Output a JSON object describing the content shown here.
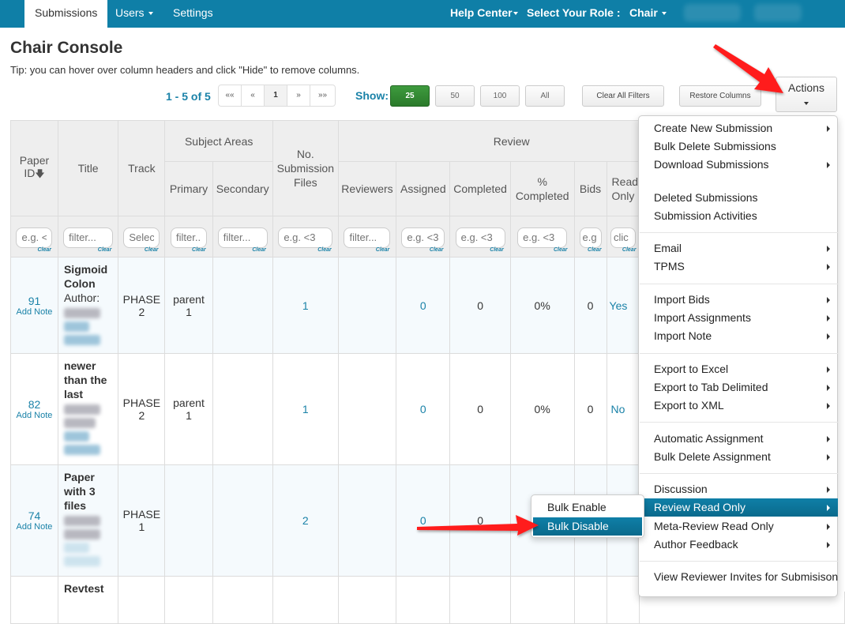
{
  "navbar": {
    "tabs": [
      {
        "label": "Submissions",
        "active": true
      },
      {
        "label": "Users",
        "has_dropdown": true
      },
      {
        "label": "Settings"
      }
    ],
    "help_center": "Help Center",
    "role_label": "Select Your Role :",
    "role_value": "Chair"
  },
  "header": {
    "title": "Chair Console",
    "tip": "Tip: you can hover over column headers and click \"Hide\" to remove columns."
  },
  "toolbar": {
    "range": "1 - 5 of 5",
    "pager": {
      "first": "««",
      "prev": "«",
      "current": "1",
      "next": "»",
      "last": "»»"
    },
    "show_label": "Show:",
    "page_sizes": [
      "25",
      "50",
      "100",
      "All"
    ],
    "selected_page_size": "25",
    "clear_filters": "Clear All Filters",
    "restore_columns": "Restore Columns",
    "actions": "Actions"
  },
  "table": {
    "headers": {
      "paper_id": "Paper ID",
      "title": "Title",
      "track": "Track",
      "subject_areas": "Subject Areas",
      "primary": "Primary",
      "secondary": "Secondary",
      "num_files": "No. Submission Files",
      "review": "Review",
      "reviewers": "Reviewers",
      "assigned": "Assigned",
      "completed": "Completed",
      "pct_completed": "% Completed",
      "bids": "Bids",
      "read_only": "Read Only"
    },
    "filters": {
      "paper_id": "e.g. <",
      "title": "filter...",
      "track": "Select",
      "primary": "filter...",
      "secondary": "filter...",
      "num_files": "e.g. <3",
      "reviewers": "filter...",
      "assigned": "e.g. <3",
      "completed": "e.g. <3",
      "pct_completed": "e.g. <3",
      "bids": "e.g",
      "read_only": "clic",
      "clear": "Clear"
    },
    "rows": [
      {
        "id": "91",
        "add_note": "Add Note",
        "title": "Sigmoid Colon",
        "author_label": "Author:",
        "track_line1": "PHASE",
        "track_line2": "2",
        "primary_line1": "parent",
        "primary_line2": "1",
        "secondary": "",
        "num_files": "1",
        "reviewers": "",
        "assigned": "0",
        "completed": "0",
        "pct_completed": "0%",
        "bids": "0",
        "read_only": "Yes"
      },
      {
        "id": "82",
        "add_note": "Add Note",
        "title": "newer than the last",
        "author_label": "",
        "track_line1": "PHASE",
        "track_line2": "2",
        "primary_line1": "parent",
        "primary_line2": "1",
        "secondary": "",
        "num_files": "1",
        "reviewers": "",
        "assigned": "0",
        "completed": "0",
        "pct_completed": "0%",
        "bids": "0",
        "read_only": "No"
      },
      {
        "id": "74",
        "add_note": "Add Note",
        "title": "Paper with 3 files",
        "author_label": "",
        "track_line1": "PHASE",
        "track_line2": "1",
        "primary_line1": "",
        "primary_line2": "",
        "secondary": "",
        "num_files": "2",
        "reviewers": "",
        "assigned": "0",
        "completed": "0",
        "pct_completed": "",
        "bids": "",
        "read_only": ""
      },
      {
        "id": "",
        "add_note": "",
        "title": "Revtest",
        "author_label": "",
        "track_line1": "",
        "track_line2": "",
        "primary_line1": "",
        "primary_line2": "",
        "secondary": "",
        "num_files": "",
        "reviewers": "",
        "assigned": "",
        "completed": "",
        "pct_completed": "",
        "bids": "",
        "read_only": ""
      }
    ]
  },
  "actions_menu": {
    "groups": [
      [
        {
          "label": "Create New Submission",
          "submenu": true
        },
        {
          "label": "Bulk Delete Submissions",
          "submenu": false
        },
        {
          "label": "Download Submissions",
          "submenu": true
        },
        {
          "label": "",
          "spacer": true
        },
        {
          "label": "Deleted Submissions",
          "submenu": false
        },
        {
          "label": "Submission Activities",
          "submenu": false
        }
      ],
      [
        {
          "label": "Email",
          "submenu": true
        },
        {
          "label": "TPMS",
          "submenu": true
        }
      ],
      [
        {
          "label": "Import Bids",
          "submenu": true
        },
        {
          "label": "Import Assignments",
          "submenu": true
        },
        {
          "label": "Import Note",
          "submenu": true
        }
      ],
      [
        {
          "label": "Export to Excel",
          "submenu": true
        },
        {
          "label": "Export to Tab Delimited",
          "submenu": true
        },
        {
          "label": "Export to XML",
          "submenu": true
        }
      ],
      [
        {
          "label": "Automatic Assignment",
          "submenu": true
        },
        {
          "label": "Bulk Delete Assignment",
          "submenu": true
        }
      ],
      [
        {
          "label": "Discussion",
          "submenu": true
        },
        {
          "label": "Review Read Only",
          "submenu": true,
          "highlighted": true
        },
        {
          "label": "Meta-Review Read Only",
          "submenu": true
        },
        {
          "label": "Author Feedback",
          "submenu": true
        }
      ],
      [
        {
          "label": "View Reviewer Invites for Submisison",
          "submenu": false
        }
      ]
    ],
    "review_read_only_submenu": [
      {
        "label": "Bulk Enable",
        "highlighted": false
      },
      {
        "label": "Bulk Disable",
        "highlighted": true
      }
    ]
  },
  "colors": {
    "brand": "#0f7fa7",
    "link": "#1a82a8",
    "active_green": "#2f8a2f",
    "annotation_arrow": "#ff0000"
  }
}
